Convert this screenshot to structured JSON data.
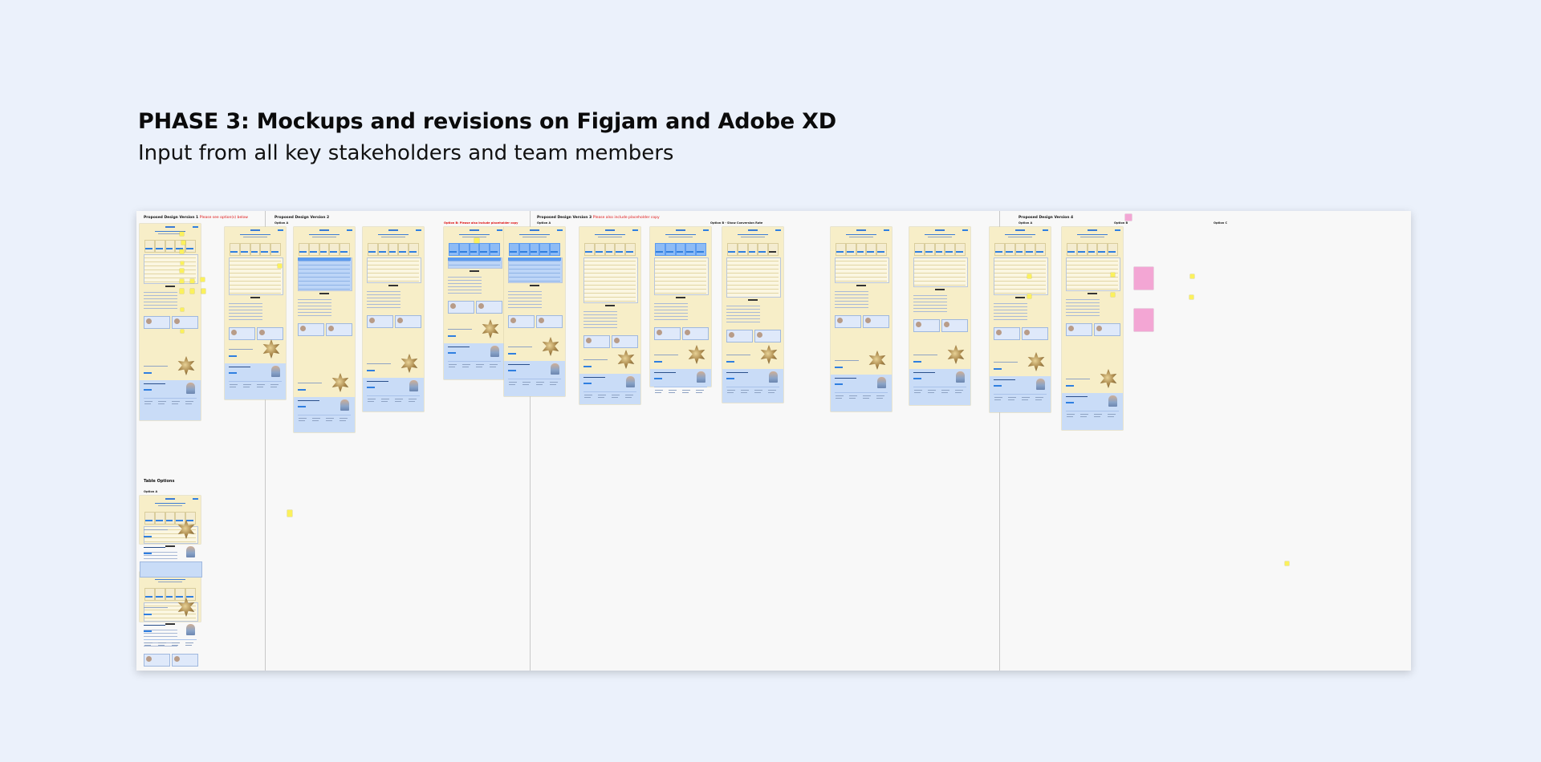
{
  "header": {
    "title": "PHASE 3: Mockups and revisions on Figjam and Adobe XD",
    "subtitle": "Input from all key stakeholders and team members"
  },
  "board": {
    "sections": [
      {
        "label": "Proposed Design Version 1",
        "note": "Please see option(s) below"
      },
      {
        "label": "Proposed Design Version 2",
        "note": ""
      },
      {
        "label": "Proposed Design Version 3",
        "note": "Please also include placeholder copy"
      },
      {
        "label": "Proposed Design Version 4",
        "note": ""
      }
    ],
    "options": {
      "v2_a": "Option A",
      "v2_b_note": "Option B: Please also include placeholder copy",
      "v3_a": "Option A",
      "v3_b": "Option B - Show Conversion Rate",
      "v4_a": "Option A",
      "v4_b": "Option B",
      "v4_c": "Option C"
    },
    "table_options": {
      "label": "Table Options",
      "option_a": "Option A",
      "option_b": "Option B"
    }
  },
  "colors": {
    "background": "#ebf1fb",
    "mockup_cream": "#f7eec8",
    "mockup_blue": "#c9dcf7",
    "sticky_yellow": "#fbf15c",
    "sticky_pink": "#f3a6d4",
    "accent_blue": "#2f7fe0"
  }
}
